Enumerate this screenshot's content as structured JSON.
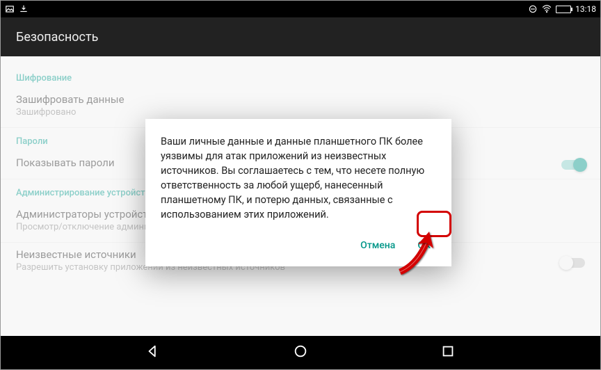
{
  "statusbar": {
    "clock": "13:18",
    "icons": {
      "picture": "picture-icon",
      "download": "download-complete-icon",
      "dnd": "do-not-disturb-icon",
      "wifi": "wifi-icon",
      "battery": "battery-icon"
    }
  },
  "header": {
    "title": "Безопасность"
  },
  "sections": {
    "encryption": {
      "label": "Шифрование",
      "row": {
        "title": "Зашифровать данные",
        "sub": "Зашифровано"
      }
    },
    "passwords": {
      "label": "Пароли",
      "row": {
        "title": "Показывать пароли",
        "switch_on": true
      }
    },
    "admin": {
      "label": "Администрирование устройства",
      "row": {
        "title": "Администраторы устройства",
        "sub": "Просмотр/отключение администраторов"
      }
    },
    "unknown": {
      "row": {
        "title": "Неизвестные источники",
        "sub": "Разрешить установку приложений из неизвестных источников",
        "switch_on": false
      }
    }
  },
  "dialog": {
    "text": "Ваши личные данные и данные планшетного ПК более уязвимы для атак приложений из неизвестных источников. Вы соглашаетесь с тем, что несете полную ответственность за любой ущерб, нанесенный планшетному ПК, и потерю данных, связанные с использованием этих приложений.",
    "cancel": "Отмена",
    "ok": "ОК"
  },
  "navbar": {
    "back": "back-icon",
    "home": "home-icon",
    "recent": "recent-icon"
  },
  "colors": {
    "accent": "#009688",
    "highlight": "#d30000"
  }
}
